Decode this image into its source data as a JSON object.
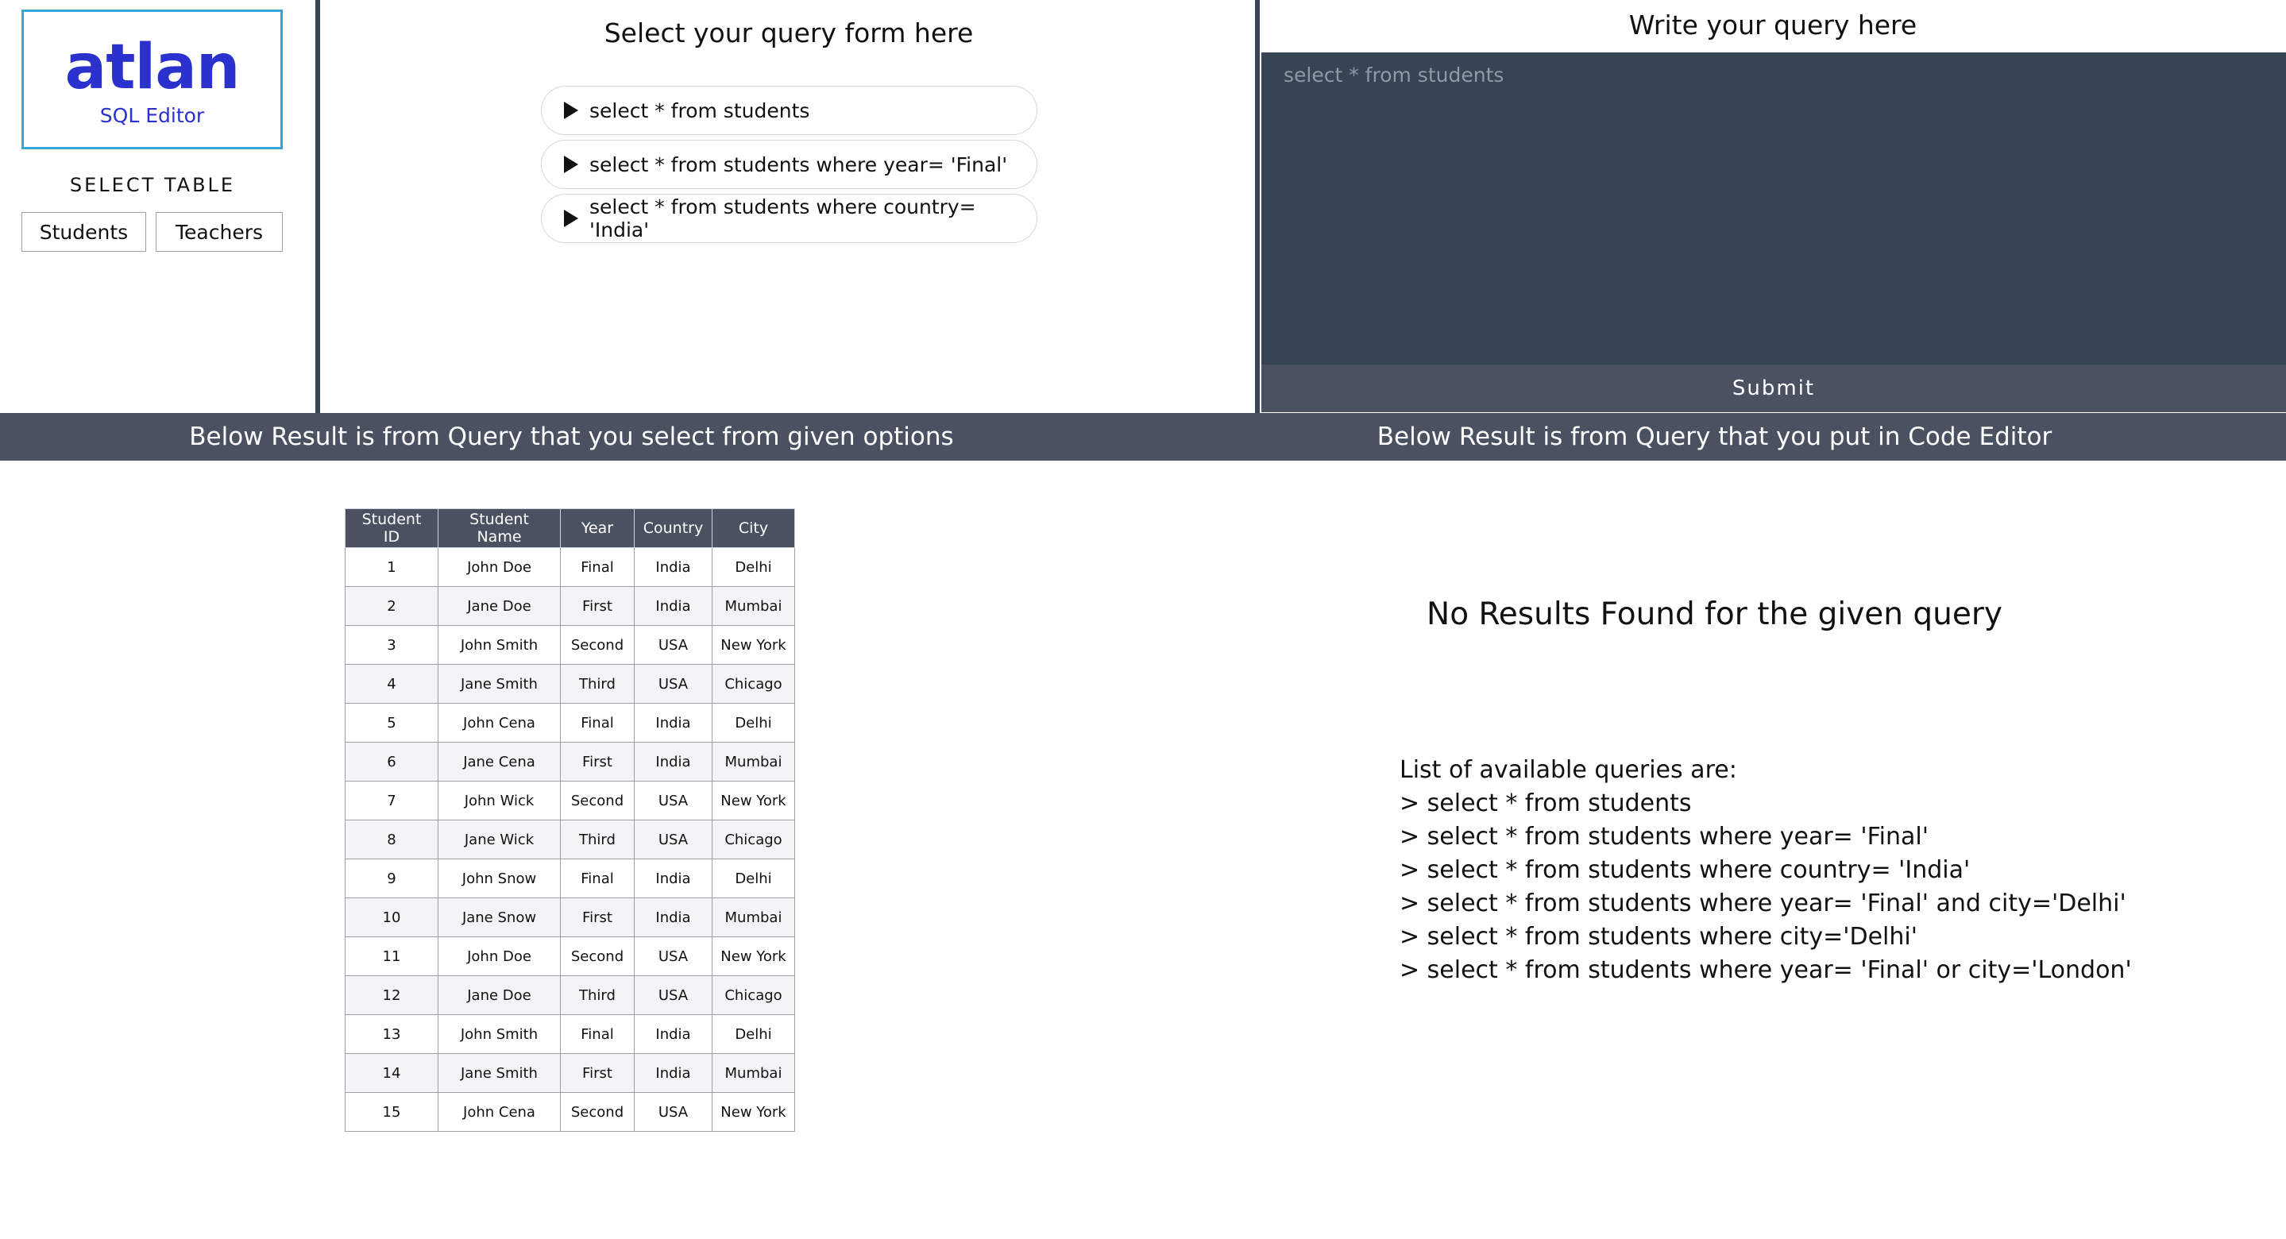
{
  "sidebar": {
    "logo_text": "atlan",
    "logo_subtitle": "SQL Editor",
    "select_table_label": "SELECT TABLE",
    "buttons": [
      "Students",
      "Teachers"
    ]
  },
  "query_form": {
    "title": "Select your query form here",
    "options": [
      "select * from students",
      "select * from students where year= 'Final'",
      "select * from students where country= 'India'"
    ]
  },
  "editor": {
    "title": "Write your query here",
    "placeholder": "select * from students",
    "submit_label": "Submit"
  },
  "results": {
    "left_banner": "Below Result is from Query that you select from given options",
    "right_banner": "Below Result is from Query that you put in Code Editor",
    "table": {
      "headers": [
        "Student ID",
        "Student Name",
        "Year",
        "Country",
        "City"
      ],
      "rows": [
        [
          "1",
          "John Doe",
          "Final",
          "India",
          "Delhi"
        ],
        [
          "2",
          "Jane Doe",
          "First",
          "India",
          "Mumbai"
        ],
        [
          "3",
          "John Smith",
          "Second",
          "USA",
          "New York"
        ],
        [
          "4",
          "Jane Smith",
          "Third",
          "USA",
          "Chicago"
        ],
        [
          "5",
          "John Cena",
          "Final",
          "India",
          "Delhi"
        ],
        [
          "6",
          "Jane Cena",
          "First",
          "India",
          "Mumbai"
        ],
        [
          "7",
          "John Wick",
          "Second",
          "USA",
          "New York"
        ],
        [
          "8",
          "Jane Wick",
          "Third",
          "USA",
          "Chicago"
        ],
        [
          "9",
          "John Snow",
          "Final",
          "India",
          "Delhi"
        ],
        [
          "10",
          "Jane Snow",
          "First",
          "India",
          "Mumbai"
        ],
        [
          "11",
          "John Doe",
          "Second",
          "USA",
          "New York"
        ],
        [
          "12",
          "Jane Doe",
          "Third",
          "USA",
          "Chicago"
        ],
        [
          "13",
          "John Smith",
          "Final",
          "India",
          "Delhi"
        ],
        [
          "14",
          "Jane Smith",
          "First",
          "India",
          "Mumbai"
        ],
        [
          "15",
          "John Cena",
          "Second",
          "USA",
          "New York"
        ]
      ]
    },
    "no_results": "No Results Found for the given query",
    "available_heading": "List of available queries are:",
    "available_queries": [
      "> select * from students",
      "> select * from students where year= 'Final'",
      "> select * from students where country= 'India'",
      "> select * from students where year= 'Final' and city='Delhi'",
      "> select * from students where city='Delhi'",
      "> select * from students where year= 'Final' or city='London'"
    ]
  },
  "colors": {
    "brand": "#2a31cc",
    "logo_border": "#3aa3d8",
    "editor_bg": "#384354",
    "banner_bg": "#4a5261"
  }
}
